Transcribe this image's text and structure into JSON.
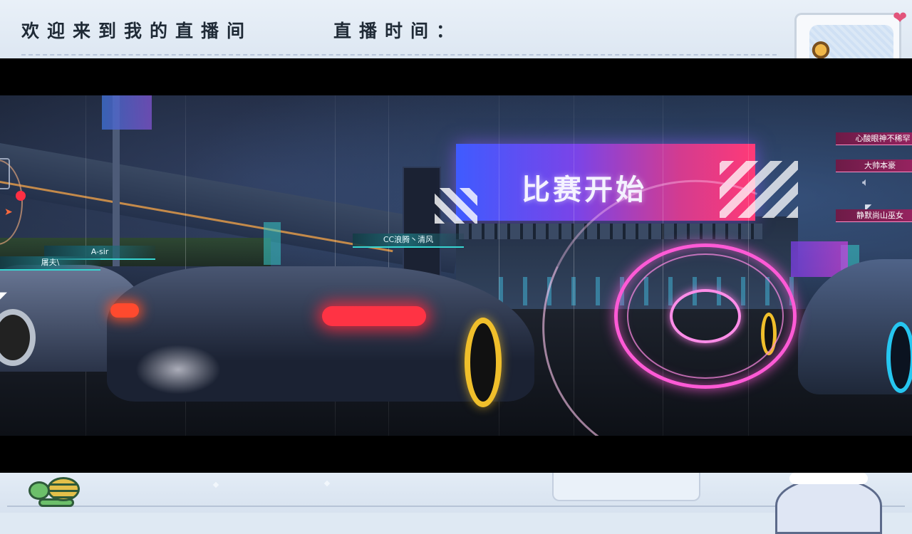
{
  "header": {
    "welcome_text": "欢迎来到我的直播间",
    "stream_time_label": "直播时间："
  },
  "game": {
    "banner_text": "比赛开始",
    "player_tags": [
      "CC浪腾丶清风",
      "A-sir",
      "屠夫\\"
    ],
    "chat_messages": [
      "心酸眼神不稀罕",
      "大帅本豪",
      "静默尚山巫女"
    ]
  },
  "colors": {
    "banner_start": "#3f5bff",
    "banner_end": "#ff3a77",
    "neon_ring": "#ff5ad6",
    "tag_accent": "#37d6d2",
    "chat_bg": "#9c2463",
    "overlay_bg": "#dfe9f3"
  },
  "icons": [
    "heart-icon",
    "speaker-icon",
    "turtle-icon",
    "mascot-icon",
    "red-dot-marker",
    "cursor-icon"
  ]
}
